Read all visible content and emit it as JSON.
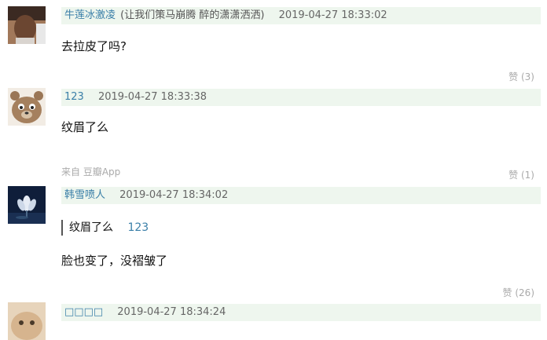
{
  "comments": [
    {
      "author": "牛莲冰激凌",
      "status": "(让我们策马崩腾 醉的潇潇洒洒)",
      "time": "2019-04-27 18:33:02",
      "text": "去拉皮了吗?",
      "likes": "赞 (3)"
    },
    {
      "author": "123",
      "time": "2019-04-27 18:33:38",
      "text": "纹眉了么",
      "source": "来自 豆瓣App",
      "likes": "赞 (1)"
    },
    {
      "author": "韩雪喷人",
      "time": "2019-04-27 18:34:02",
      "quote_text": "纹眉了么",
      "quote_author": "123",
      "text": "脸也变了，没褶皱了",
      "likes": "赞 (26)"
    },
    {
      "author": "□□□□",
      "time": "2019-04-27 18:34:24"
    }
  ],
  "colors": {
    "meta_bar": "#eef6ee",
    "author_link": "#3a7fa8"
  }
}
